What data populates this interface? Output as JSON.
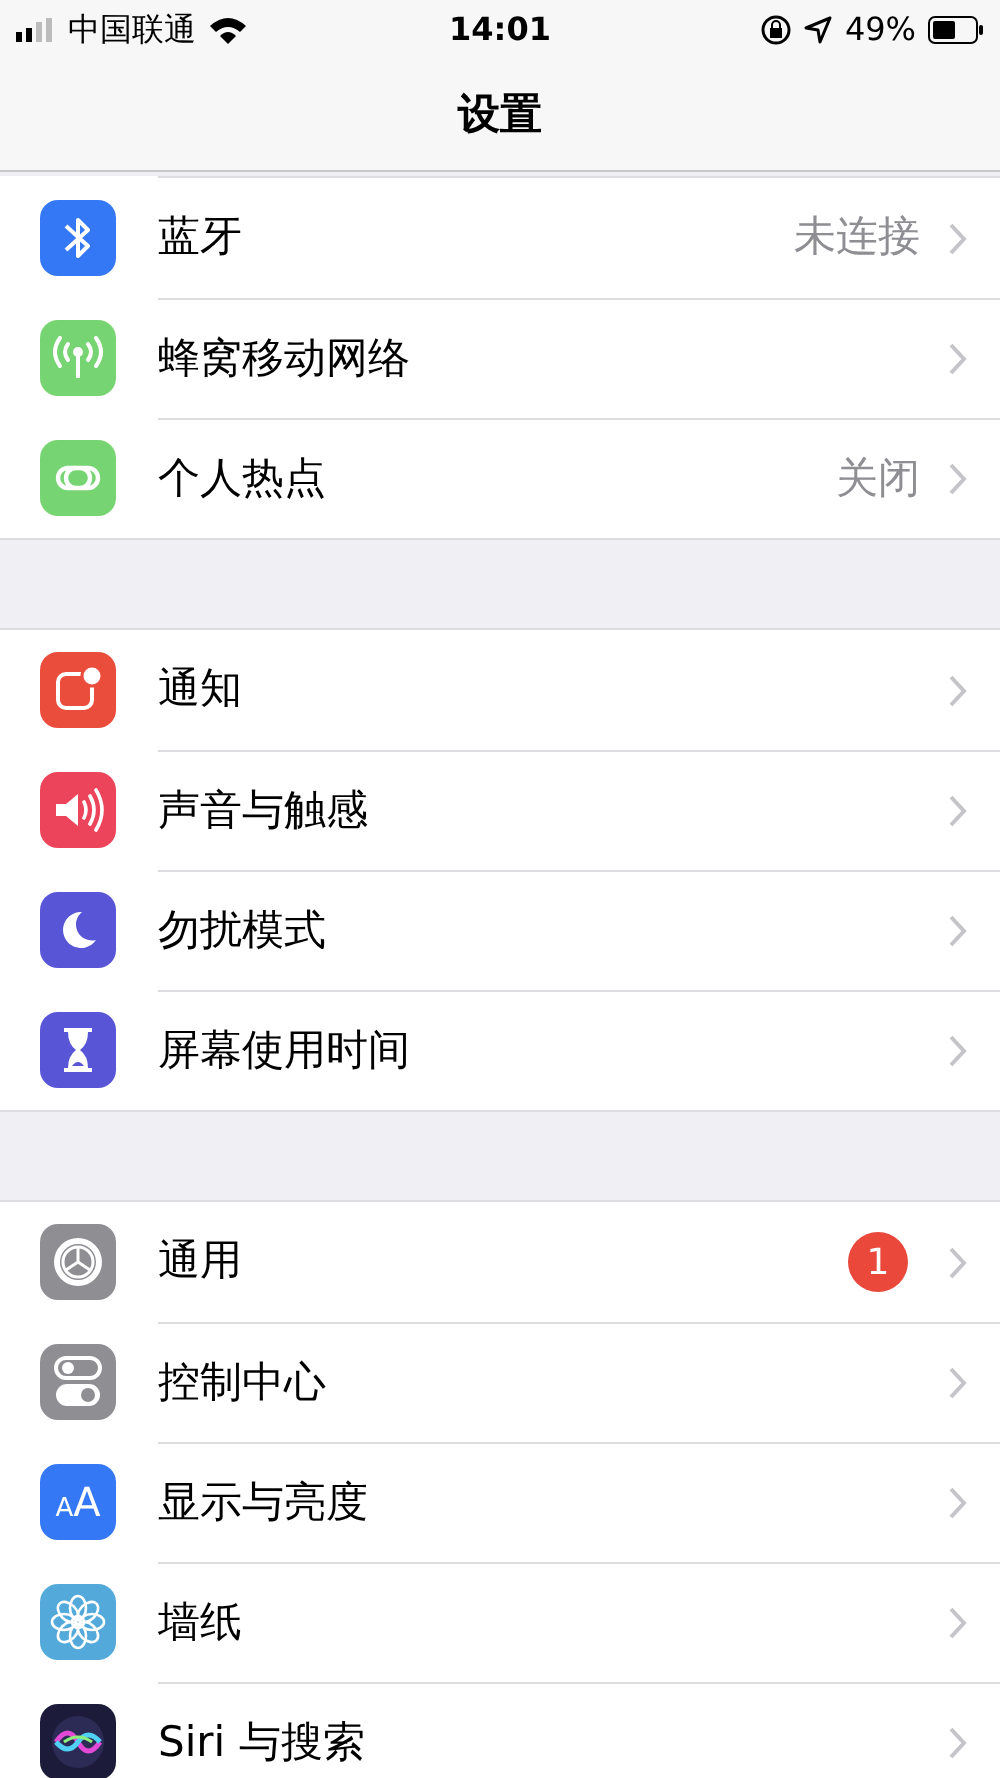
{
  "status_bar": {
    "carrier": "中国联通",
    "time": "14:01",
    "battery": "49%"
  },
  "nav": {
    "title": "设置"
  },
  "groups": [
    {
      "items": [
        {
          "kind": "bluetooth",
          "color": "#3478f6",
          "label": "蓝牙",
          "value": "未连接"
        },
        {
          "kind": "cellular",
          "color": "#76d572",
          "label": "蜂窝移动网络"
        },
        {
          "kind": "hotspot",
          "color": "#76d572",
          "label": "个人热点",
          "value": "关闭"
        }
      ]
    },
    {
      "items": [
        {
          "kind": "notifications",
          "color": "#eb4d3d",
          "label": "通知"
        },
        {
          "kind": "sounds",
          "color": "#ec445a",
          "label": "声音与触感"
        },
        {
          "kind": "moon",
          "color": "#5856d6",
          "label": "勿扰模式"
        },
        {
          "kind": "hourglass",
          "color": "#5856d6",
          "label": "屏幕使用时间"
        }
      ]
    },
    {
      "items": [
        {
          "kind": "gear",
          "color": "#8e8e93",
          "label": "通用",
          "badge": "1"
        },
        {
          "kind": "toggles",
          "color": "#8e8e93",
          "label": "控制中心"
        },
        {
          "kind": "textsize",
          "color": "#3478f6",
          "label": "显示与亮度",
          "icon_glyphs": [
            "A",
            "A"
          ]
        },
        {
          "kind": "flower",
          "color": "#54a9db",
          "label": "墙纸"
        },
        {
          "kind": "siri",
          "color": "#1c1c3a",
          "label": "Siri 与搜索"
        }
      ]
    }
  ]
}
